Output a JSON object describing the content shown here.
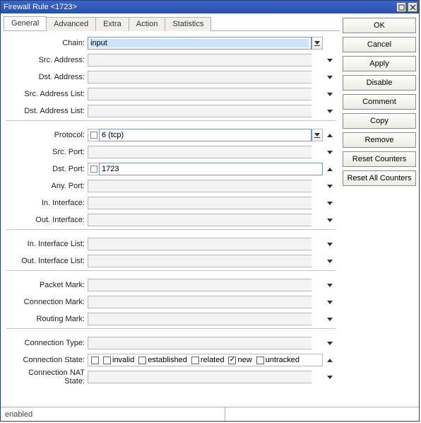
{
  "title": "Firewall Rule <1723>",
  "tabs": [
    "General",
    "Advanced",
    "Extra",
    "Action",
    "Statistics"
  ],
  "labels": {
    "chain": "Chain:",
    "src_address": "Src. Address:",
    "dst_address": "Dst. Address:",
    "src_address_list": "Src. Address List:",
    "dst_address_list": "Dst. Address List:",
    "protocol": "Protocol:",
    "src_port": "Src. Port:",
    "dst_port": "Dst. Port:",
    "any_port": "Any. Port:",
    "in_interface": "In. Interface:",
    "out_interface": "Out. Interface:",
    "in_interface_list": "In. Interface List:",
    "out_interface_list": "Out. Interface List:",
    "packet_mark": "Packet Mark:",
    "connection_mark": "Connection Mark:",
    "routing_mark": "Routing Mark:",
    "connection_type": "Connection Type:",
    "connection_state": "Connection State:",
    "connection_nat_state": "Connection NAT State:"
  },
  "values": {
    "chain": "input",
    "protocol": "6 (tcp)",
    "dst_port": "1723"
  },
  "conn_state_opts": {
    "invalid": "invalid",
    "established": "established",
    "related": "related",
    "new": "new",
    "untracked": "untracked"
  },
  "buttons": {
    "ok": "OK",
    "cancel": "Cancel",
    "apply": "Apply",
    "disable": "Disable",
    "comment": "Comment",
    "copy": "Copy",
    "remove": "Remove",
    "reset_counters": "Reset Counters",
    "reset_all_counters": "Reset All Counters"
  },
  "status": "enabled"
}
